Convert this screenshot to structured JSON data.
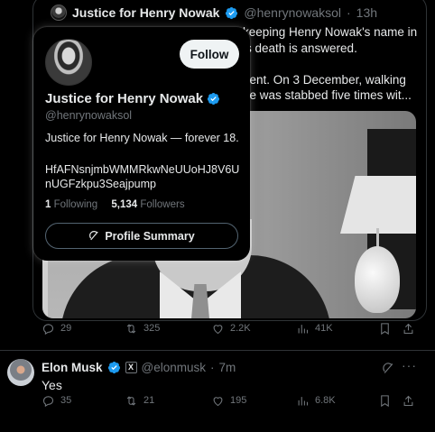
{
  "colors": {
    "verified": "#1d9bf0",
    "muted": "#71767b",
    "text": "#e7e9ea",
    "background": "#000000"
  },
  "quote": {
    "name": "Justice for Henry Nowak",
    "handle": "@henrynowaksol",
    "separator": "·",
    "time": "13h",
    "text_lines": [
      "keeping Henry Nowak's name in",
      "is death is answered.",
      "",
      "dent. On 3 December, walking",
      "he was stabbed five times wit..."
    ]
  },
  "quote_actions": {
    "replies": "29",
    "reposts": "325",
    "likes": "2.2K",
    "views": "41K",
    "icons": [
      "reply-icon",
      "repost-icon",
      "like-icon",
      "views-icon",
      "bookmark-icon",
      "share-icon"
    ]
  },
  "hover_card": {
    "follow_label": "Follow",
    "name": "Justice for Henry Nowak",
    "handle": "@henrynowaksol",
    "bio_line1": "Justice for Henry Nowak — forever 18.",
    "bio_line2": "HfAFNsnjmbWMMRkwNeUUoHJ8V6U",
    "bio_line3": "nUGFzkpu3Seajpump",
    "following_count": "1",
    "following_label": "Following",
    "followers_count": "5,134",
    "followers_label": "Followers",
    "summary_label": "Profile Summary"
  },
  "tweet": {
    "name": "Elon Musk",
    "affiliate_badge": "X",
    "handle": "@elonmusk",
    "separator": "·",
    "time": "7m",
    "more": "···",
    "text": "Yes",
    "replies": "35",
    "reposts": "21",
    "likes": "195",
    "views": "6.8K"
  }
}
